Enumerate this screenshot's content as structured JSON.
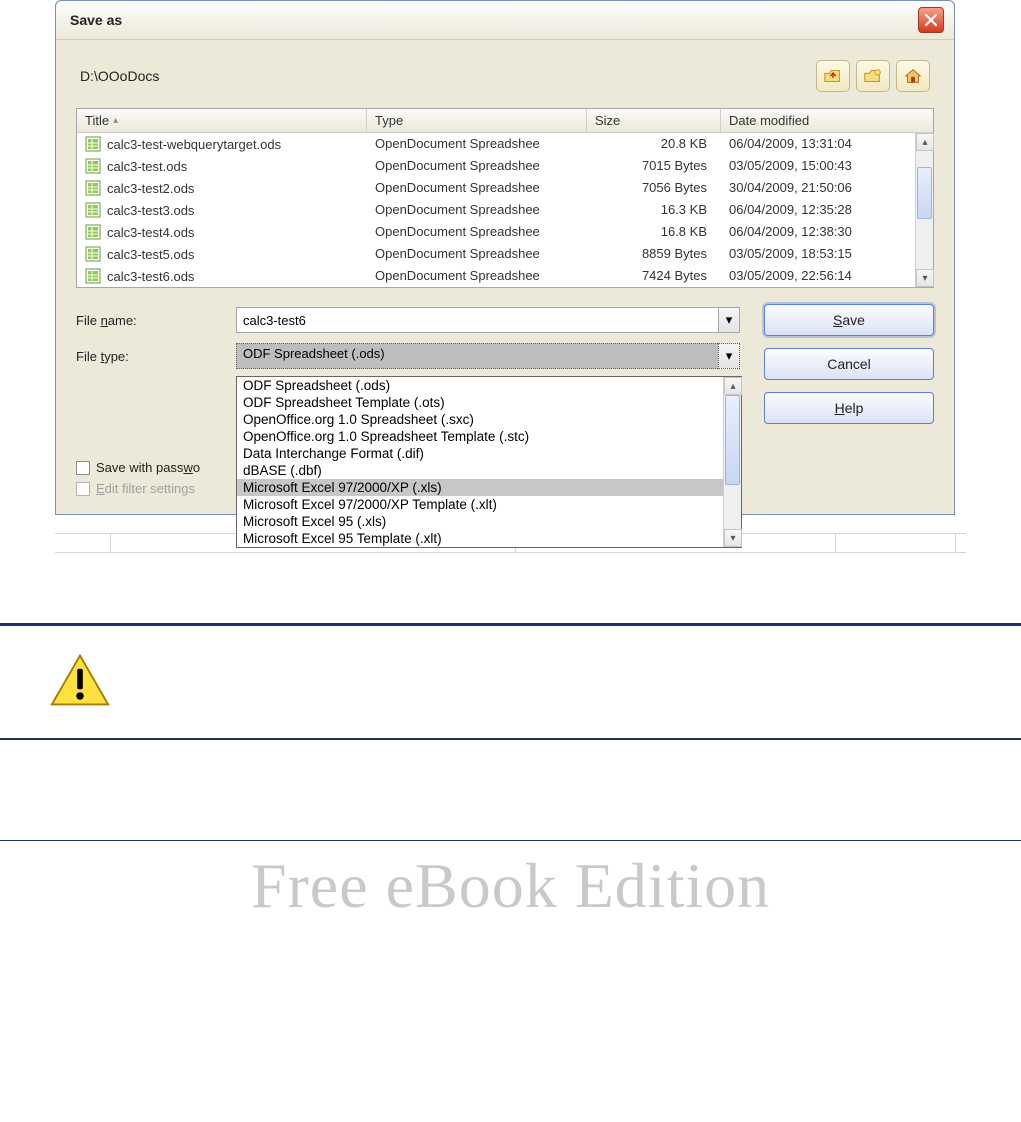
{
  "dialog": {
    "title": "Save as",
    "path": "D:\\OOoDocs",
    "columns": {
      "title": "Title",
      "type": "Type",
      "size": "Size",
      "date": "Date modified"
    },
    "files": [
      {
        "name": "calc3-test-webquerytarget.ods",
        "type": "OpenDocument Spreadshee",
        "size": "20.8 KB",
        "date": "06/04/2009, 13:31:04"
      },
      {
        "name": "calc3-test.ods",
        "type": "OpenDocument Spreadshee",
        "size": "7015 Bytes",
        "date": "03/05/2009, 15:00:43"
      },
      {
        "name": "calc3-test2.ods",
        "type": "OpenDocument Spreadshee",
        "size": "7056 Bytes",
        "date": "30/04/2009, 21:50:06"
      },
      {
        "name": "calc3-test3.ods",
        "type": "OpenDocument Spreadshee",
        "size": "16.3 KB",
        "date": "06/04/2009, 12:35:28"
      },
      {
        "name": "calc3-test4.ods",
        "type": "OpenDocument Spreadshee",
        "size": "16.8 KB",
        "date": "06/04/2009, 12:38:30"
      },
      {
        "name": "calc3-test5.ods",
        "type": "OpenDocument Spreadshee",
        "size": "8859 Bytes",
        "date": "03/05/2009, 18:53:15"
      },
      {
        "name": "calc3-test6.ods",
        "type": "OpenDocument Spreadshee",
        "size": "7424 Bytes",
        "date": "03/05/2009, 22:56:14"
      }
    ],
    "filename_label": "File name:",
    "filename_value": "calc3-test6",
    "filetype_label": "File type:",
    "filetype_value": "ODF Spreadsheet (.ods)",
    "filetype_options": [
      "ODF Spreadsheet (.ods)",
      "ODF Spreadsheet Template (.ots)",
      "OpenOffice.org 1.0 Spreadsheet (.sxc)",
      "OpenOffice.org 1.0 Spreadsheet Template (.stc)",
      "Data Interchange Format (.dif)",
      "dBASE (.dbf)",
      "Microsoft Excel 97/2000/XP (.xls)",
      "Microsoft Excel 97/2000/XP Template (.xlt)",
      "Microsoft Excel 95 (.xls)",
      "Microsoft Excel 95 Template (.xlt)"
    ],
    "highlighted_option_index": 6,
    "save_password_label": "Save with password",
    "edit_filter_label": "Edit filter settings",
    "buttons": {
      "save": "Save",
      "cancel": "Cancel",
      "help": "Help"
    }
  },
  "watermark": "Free eBook Edition"
}
